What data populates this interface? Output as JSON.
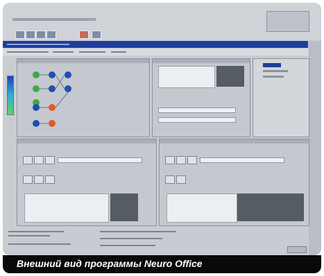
{
  "caption": {
    "text": "Внешний вид программы Neuro Office"
  },
  "colors": {
    "title_bar": "#1f3e9c",
    "node_blue": "#1f4fae",
    "node_green": "#3daa45",
    "node_orange": "#e05a2a",
    "dark_fill": "#555c63"
  },
  "icons": {
    "toolbar": [
      "toolbar-button-icon",
      "toolbar-button-icon",
      "toolbar-button-icon",
      "toolbar-button-icon",
      "toolbar-button-icon"
    ],
    "tree": "tree-node-icon"
  }
}
